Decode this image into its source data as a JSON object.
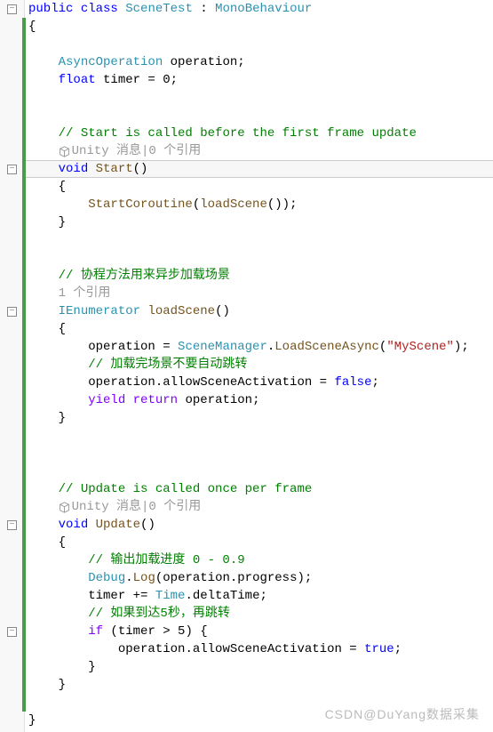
{
  "lines": [
    {
      "gutter": "minus",
      "indent": 0,
      "tokens": [
        {
          "cls": "kw",
          "t": "public"
        },
        {
          "t": " "
        },
        {
          "cls": "kw",
          "t": "class"
        },
        {
          "t": " "
        },
        {
          "cls": "type",
          "t": "SceneTest"
        },
        {
          "t": " : "
        },
        {
          "cls": "type",
          "t": "MonoBehaviour"
        }
      ]
    },
    {
      "indent": 0,
      "tokens": [
        {
          "t": "{"
        }
      ],
      "bar": [
        1,
        40
      ]
    },
    {
      "indent": 2,
      "tokens": []
    },
    {
      "indent": 2,
      "tokens": [
        {
          "cls": "type",
          "t": "AsyncOperation"
        },
        {
          "t": " operation;"
        }
      ]
    },
    {
      "indent": 2,
      "tokens": [
        {
          "cls": "kw",
          "t": "float"
        },
        {
          "t": " timer = 0;"
        }
      ]
    },
    {
      "indent": 2,
      "tokens": []
    },
    {
      "indent": 2,
      "tokens": []
    },
    {
      "indent": 2,
      "tokens": [
        {
          "cls": "comment",
          "t": "// Start is called before the first frame update"
        }
      ]
    },
    {
      "indent": 2,
      "tokens": [
        {
          "cls": "annotation",
          "t": "Unity 消息|0 个引用"
        }
      ],
      "cube": true
    },
    {
      "gutter": "minus",
      "indent": 2,
      "tokens": [
        {
          "cls": "kw",
          "t": "void"
        },
        {
          "t": " "
        },
        {
          "cls": "method-call",
          "t": "Start"
        },
        {
          "t": "()"
        }
      ],
      "highlight": true
    },
    {
      "indent": 2,
      "tokens": [
        {
          "t": "{"
        }
      ]
    },
    {
      "indent": 4,
      "tokens": [
        {
          "cls": "method-call",
          "t": "StartCoroutine"
        },
        {
          "t": "("
        },
        {
          "cls": "method-call",
          "t": "loadScene"
        },
        {
          "t": "());"
        }
      ]
    },
    {
      "indent": 2,
      "tokens": [
        {
          "t": "}"
        }
      ]
    },
    {
      "indent": 2,
      "tokens": []
    },
    {
      "indent": 2,
      "tokens": []
    },
    {
      "indent": 2,
      "tokens": [
        {
          "cls": "comment",
          "t": "// 协程方法用来异步加载场景"
        }
      ]
    },
    {
      "indent": 2,
      "tokens": [
        {
          "cls": "annotation",
          "t": "1 个引用"
        }
      ]
    },
    {
      "gutter": "minus",
      "indent": 2,
      "tokens": [
        {
          "cls": "type",
          "t": "IEnumerator"
        },
        {
          "t": " "
        },
        {
          "cls": "method-call",
          "t": "loadScene"
        },
        {
          "t": "()"
        }
      ]
    },
    {
      "indent": 2,
      "tokens": [
        {
          "t": "{"
        }
      ]
    },
    {
      "indent": 4,
      "tokens": [
        {
          "t": "operation = "
        },
        {
          "cls": "type",
          "t": "SceneManager"
        },
        {
          "t": "."
        },
        {
          "cls": "method-call",
          "t": "LoadSceneAsync"
        },
        {
          "t": "("
        },
        {
          "cls": "string",
          "t": "\"MyScene\""
        },
        {
          "t": ");"
        }
      ]
    },
    {
      "indent": 4,
      "tokens": [
        {
          "cls": "comment",
          "t": "// 加载完场景不要自动跳转"
        }
      ]
    },
    {
      "indent": 4,
      "tokens": [
        {
          "t": "operation.allowSceneActivation = "
        },
        {
          "cls": "kw",
          "t": "false"
        },
        {
          "t": ";"
        }
      ]
    },
    {
      "indent": 4,
      "tokens": [
        {
          "cls": "purple",
          "t": "yield"
        },
        {
          "t": " "
        },
        {
          "cls": "purple",
          "t": "return"
        },
        {
          "t": " operation;"
        }
      ]
    },
    {
      "indent": 2,
      "tokens": [
        {
          "t": "}"
        }
      ]
    },
    {
      "indent": 2,
      "tokens": []
    },
    {
      "indent": 2,
      "tokens": []
    },
    {
      "indent": 2,
      "tokens": []
    },
    {
      "indent": 2,
      "tokens": [
        {
          "cls": "comment",
          "t": "// Update is called once per frame"
        }
      ]
    },
    {
      "indent": 2,
      "tokens": [
        {
          "cls": "annotation",
          "t": "Unity 消息|0 个引用"
        }
      ],
      "cube": true
    },
    {
      "gutter": "minus",
      "indent": 2,
      "tokens": [
        {
          "cls": "kw",
          "t": "void"
        },
        {
          "t": " "
        },
        {
          "cls": "method-call",
          "t": "Update"
        },
        {
          "t": "()"
        }
      ]
    },
    {
      "indent": 2,
      "tokens": [
        {
          "t": "{"
        }
      ]
    },
    {
      "indent": 4,
      "tokens": [
        {
          "cls": "comment",
          "t": "// 输出加载进度 0 - 0.9"
        }
      ]
    },
    {
      "indent": 4,
      "tokens": [
        {
          "cls": "type",
          "t": "Debug"
        },
        {
          "t": "."
        },
        {
          "cls": "method-call",
          "t": "Log"
        },
        {
          "t": "(operation.progress);"
        }
      ]
    },
    {
      "indent": 4,
      "tokens": [
        {
          "t": "timer += "
        },
        {
          "cls": "type",
          "t": "Time"
        },
        {
          "t": ".deltaTime;"
        }
      ]
    },
    {
      "indent": 4,
      "tokens": [
        {
          "cls": "comment",
          "t": "// 如果到达5秒，再跳转"
        }
      ]
    },
    {
      "gutter": "minus",
      "indent": 4,
      "tokens": [
        {
          "cls": "purple",
          "t": "if"
        },
        {
          "t": " (timer > 5) {"
        }
      ]
    },
    {
      "indent": 6,
      "tokens": [
        {
          "t": "operation.allowSceneActivation = "
        },
        {
          "cls": "kw",
          "t": "true"
        },
        {
          "t": ";"
        }
      ]
    },
    {
      "indent": 4,
      "tokens": [
        {
          "t": "}"
        }
      ]
    },
    {
      "indent": 2,
      "tokens": [
        {
          "t": "}"
        }
      ]
    },
    {
      "indent": 2,
      "tokens": []
    },
    {
      "indent": 0,
      "tokens": [
        {
          "t": "}"
        }
      ]
    }
  ],
  "watermark": "CSDN@DuYang数据采集"
}
